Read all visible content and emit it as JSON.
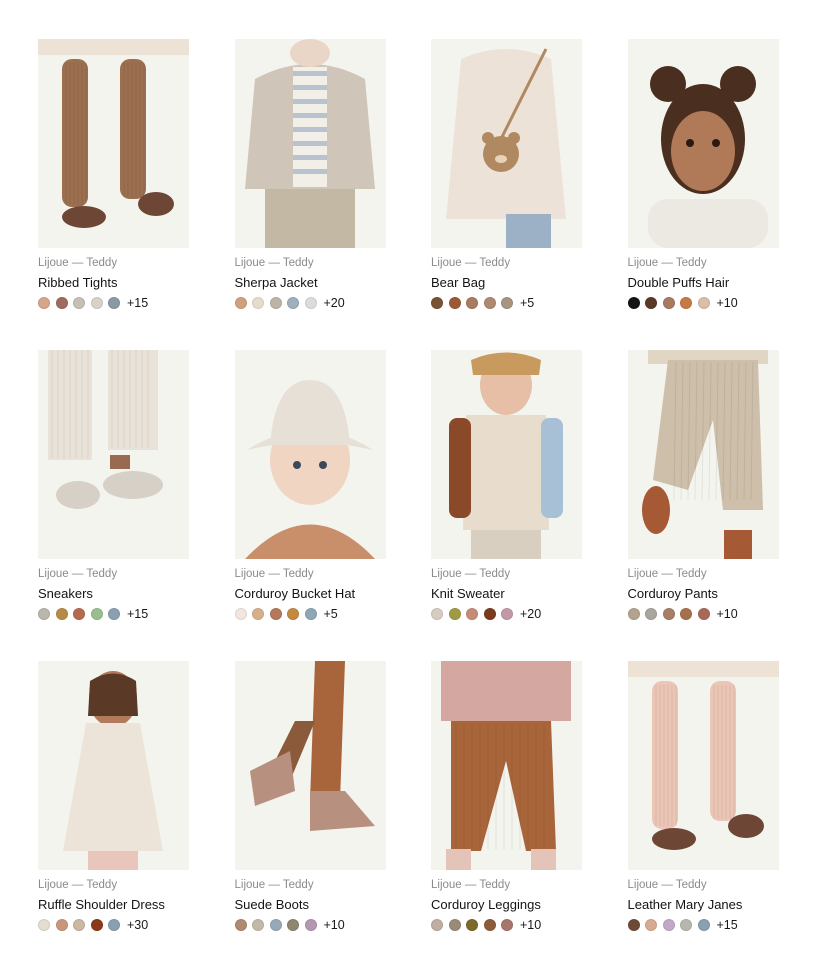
{
  "creator_label": "Lijoue — Teddy",
  "items": [
    {
      "name": "Ribbed Tights",
      "creator": "Lijoue — Teddy",
      "icon": "ribbed-tights-thumbnail",
      "art": "legs-tights",
      "palette": {
        "bg": "#f4f4ef",
        "main": "#9c6f4f",
        "accent": "#6e4636",
        "top": "#ece2d6"
      },
      "swatches": [
        "#d6a58a",
        "#9e6b5c",
        "#c7bfb3",
        "#d9d2c9",
        "#8a9aa5"
      ],
      "more": "+15"
    },
    {
      "name": "Sherpa Jacket",
      "creator": "Lijoue — Teddy",
      "icon": "sherpa-jacket-thumbnail",
      "art": "jacket",
      "palette": {
        "bg": "#f4f4ef",
        "main": "#cfc5b8",
        "accent": "#b8ab99",
        "top": "#e9d6c7"
      },
      "swatches": [
        "#d0a07d",
        "#e6dcca",
        "#bdb3a6",
        "#9fb0bd",
        "#dcdcdc"
      ],
      "more": "+20"
    },
    {
      "name": "Bear Bag",
      "creator": "Lijoue — Teddy",
      "icon": "bear-bag-thumbnail",
      "art": "bear-bag",
      "palette": {
        "bg": "#f4f4ef",
        "main": "#ece2d8",
        "accent": "#b08960",
        "top": "#9cb1c6"
      },
      "swatches": [
        "#7a5232",
        "#9a5a38",
        "#a87a5e",
        "#b08870",
        "#a89482"
      ],
      "more": "+5"
    },
    {
      "name": "Double Puffs Hair",
      "creator": "Lijoue — Teddy",
      "icon": "double-puffs-hair-thumbnail",
      "art": "hair",
      "palette": {
        "bg": "#f4f4ef",
        "main": "#4a2e1f",
        "accent": "#b07a58",
        "top": "#ece8e2"
      },
      "swatches": [
        "#141414",
        "#5a3a26",
        "#a87a62",
        "#c77a45",
        "#d8bfa6"
      ],
      "more": "+10"
    },
    {
      "name": "Sneakers",
      "creator": "Lijoue — Teddy",
      "icon": "sneakers-thumbnail",
      "art": "sneakers",
      "palette": {
        "bg": "#f4f4ef",
        "main": "#e8e2d8",
        "accent": "#d6d0c6",
        "top": "#9a6a50"
      },
      "swatches": [
        "#b9b6ad",
        "#b98a47",
        "#b66a4f",
        "#9abf8e",
        "#8a9fb2"
      ],
      "more": "+15"
    },
    {
      "name": "Corduroy Bucket Hat",
      "creator": "Lijoue — Teddy",
      "icon": "corduroy-bucket-hat-thumbnail",
      "art": "bucket-hat",
      "palette": {
        "bg": "#f4f4ef",
        "main": "#e6e0d7",
        "accent": "#c98e6a",
        "top": "#f1d5c3"
      },
      "swatches": [
        "#f3e5df",
        "#d7b08a",
        "#b6785c",
        "#c48a3f",
        "#8ea6b6"
      ],
      "more": "+5"
    },
    {
      "name": "Knit Sweater",
      "creator": "Lijoue — Teddy",
      "icon": "knit-sweater-thumbnail",
      "art": "sweater",
      "palette": {
        "bg": "#f4f4ef",
        "main": "#e8ddcc",
        "accent": "#8a4a2a",
        "top": "#a7c0d6"
      },
      "swatches": [
        "#d7ccc0",
        "#a09a44",
        "#c48c75",
        "#7a3a1c",
        "#c29aa6"
      ],
      "more": "+20"
    },
    {
      "name": "Corduroy Pants",
      "creator": "Lijoue — Teddy",
      "icon": "corduroy-pants-thumbnail",
      "art": "pants",
      "palette": {
        "bg": "#f4f4ef",
        "main": "#cdbfa9",
        "accent": "#a55a35",
        "top": "#e1d6c4"
      },
      "swatches": [
        "#b2a28e",
        "#a8a69e",
        "#a87e66",
        "#a6704c",
        "#a86a58"
      ],
      "more": "+10"
    },
    {
      "name": "Ruffle Shoulder Dress",
      "creator": "Lijoue — Teddy",
      "icon": "ruffle-shoulder-dress-thumbnail",
      "art": "dress",
      "palette": {
        "bg": "#f4f4ef",
        "main": "#ece4d8",
        "accent": "#5a3a26",
        "top": "#b27a5a"
      },
      "swatches": [
        "#e4ddd2",
        "#c9967a",
        "#cbb8a3",
        "#8a3a1a",
        "#8aa0b0"
      ],
      "more": "+30"
    },
    {
      "name": "Suede Boots",
      "creator": "Lijoue — Teddy",
      "icon": "suede-boots-thumbnail",
      "art": "boots",
      "palette": {
        "bg": "#f4f4ef",
        "main": "#b89080",
        "accent": "#a8643a",
        "top": "#8a5a3a"
      },
      "swatches": [
        "#ad8a70",
        "#c3b9ab",
        "#97a8b7",
        "#8d8670",
        "#b497b0"
      ],
      "more": "+10"
    },
    {
      "name": "Corduroy Leggings",
      "creator": "Lijoue — Teddy",
      "icon": "corduroy-leggings-thumbnail",
      "art": "leggings",
      "palette": {
        "bg": "#f4f4ef",
        "main": "#a8653a",
        "accent": "#e4c4b8",
        "top": "#d4a7a0"
      },
      "swatches": [
        "#bfaea2",
        "#9a8a78",
        "#7b6a2a",
        "#8e5a3c",
        "#a8756a"
      ],
      "more": "+10"
    },
    {
      "name": "Leather Mary Janes",
      "creator": "Lijoue — Teddy",
      "icon": "leather-mary-janes-thumbnail",
      "art": "legs-tights",
      "palette": {
        "bg": "#f4f4ef",
        "main": "#ebc6b6",
        "accent": "#6e4636",
        "top": "#ece2d6"
      },
      "swatches": [
        "#6e4a35",
        "#d7aa92",
        "#c4a8c8",
        "#b9b6b0",
        "#8aa0b0"
      ],
      "more": "+15"
    }
  ]
}
